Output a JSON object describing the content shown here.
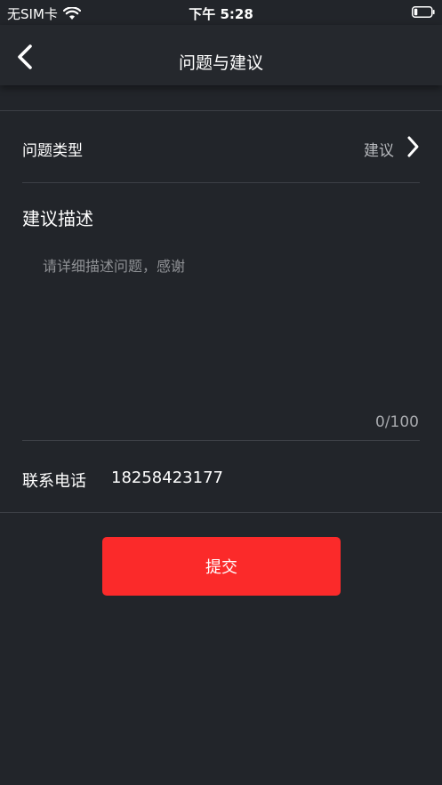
{
  "status_bar": {
    "carrier": "无SIM卡",
    "time": "下午 5:28",
    "icons": [
      "wifi-icon",
      "battery-icon"
    ]
  },
  "nav": {
    "title": "问题与建议",
    "back_icon": "chevron-left-icon"
  },
  "form": {
    "type_label": "问题类型",
    "type_value": "建议",
    "type_icon": "chevron-right-icon",
    "description_title": "建议描述",
    "description_value": "",
    "description_placeholder": "请详细描述问题，感谢",
    "counter": "0/100",
    "phone_label": "联系电话",
    "phone_value": "18258423177"
  },
  "actions": {
    "submit_label": "提交"
  },
  "colors": {
    "background": "#22252a",
    "accent": "#fb2a2a",
    "muted_text": "#b7b9bd",
    "divider": "#3d4046"
  }
}
